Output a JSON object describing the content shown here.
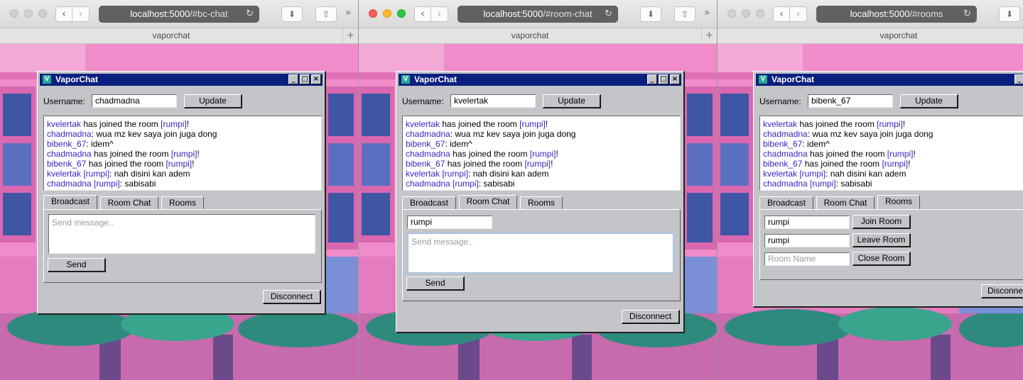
{
  "colors": {
    "title_bar": "#0a1f7f",
    "username_text": "#3b1ec2",
    "window_face": "#c3c5c9",
    "background_pink": "#ef8cc9"
  },
  "panes": [
    {
      "url_host": "localhost:5000",
      "url_path": "/#bc-chat",
      "tab_title": "vaporchat",
      "window_title": "VaporChat",
      "username_label": "Username:",
      "username_value": "chadmadna",
      "update_label": "Update",
      "active_tab": "Broadcast",
      "messages": [
        {
          "user": "kvelertak",
          "text": " has joined the room ",
          "room": "[rumpi]",
          "suffix": "!"
        },
        {
          "user": "chadmadna",
          "text": ": wua mz kev saya join juga dong",
          "room": "",
          "suffix": ""
        },
        {
          "user": "bibenk_67",
          "text": ": idem^",
          "room": "",
          "suffix": ""
        },
        {
          "user": "chadmadna",
          "text": " has joined the room ",
          "room": "[rumpi]",
          "suffix": "!"
        },
        {
          "user": "bibenk_67",
          "text": " has joined the room ",
          "room": "[rumpi]",
          "suffix": "!"
        },
        {
          "user": "kvelertak [rumpi]",
          "text": ": nah disini kan adem",
          "room": "",
          "suffix": ""
        },
        {
          "user": "chadmadna [rumpi]",
          "text": ": sabisabi",
          "room": "",
          "suffix": ""
        }
      ],
      "tabs": [
        "Broadcast",
        "Room Chat",
        "Rooms"
      ],
      "message_placeholder": "Send message..",
      "send_label": "Send",
      "disconnect_label": "Disconnect"
    },
    {
      "url_host": "localhost:5000",
      "url_path": "/#room-chat",
      "tab_title": "vaporchat",
      "window_title": "VaporChat",
      "username_label": "Username:",
      "username_value": "kvelertak",
      "update_label": "Update",
      "active_tab": "Room Chat",
      "messages": [
        {
          "user": "kvelertak",
          "text": " has joined the room ",
          "room": "[rumpi]",
          "suffix": "!"
        },
        {
          "user": "chadmadna",
          "text": ": wua mz kev saya join juga dong",
          "room": "",
          "suffix": ""
        },
        {
          "user": "bibenk_67",
          "text": ": idem^",
          "room": "",
          "suffix": ""
        },
        {
          "user": "chadmadna",
          "text": " has joined the room ",
          "room": "[rumpi]",
          "suffix": "!"
        },
        {
          "user": "bibenk_67",
          "text": " has joined the room ",
          "room": "[rumpi]",
          "suffix": "!"
        },
        {
          "user": "kvelertak [rumpi]",
          "text": ": nah disini kan adem",
          "room": "",
          "suffix": ""
        },
        {
          "user": "chadmadna [rumpi]",
          "text": ": sabisabi",
          "room": "",
          "suffix": ""
        }
      ],
      "tabs": [
        "Broadcast",
        "Room Chat",
        "Rooms"
      ],
      "room_value": "rumpi",
      "message_placeholder": "Send message..",
      "send_label": "Send",
      "disconnect_label": "Disconnect"
    },
    {
      "url_host": "localhost:5000",
      "url_path": "/#rooms",
      "tab_title": "vaporchat",
      "window_title": "VaporChat",
      "username_label": "Username:",
      "username_value": "bibenk_67",
      "update_label": "Update",
      "active_tab": "Rooms",
      "messages": [
        {
          "user": "kvelertak",
          "text": " has joined the room ",
          "room": "[rumpi]",
          "suffix": "!"
        },
        {
          "user": "chadmadna",
          "text": ": wua mz kev saya join juga dong",
          "room": "",
          "suffix": ""
        },
        {
          "user": "bibenk_67",
          "text": ": idem^",
          "room": "",
          "suffix": ""
        },
        {
          "user": "chadmadna",
          "text": " has joined the room ",
          "room": "[rumpi]",
          "suffix": "!"
        },
        {
          "user": "bibenk_67",
          "text": " has joined the room ",
          "room": "[rumpi]",
          "suffix": "!"
        },
        {
          "user": "kvelertak [rumpi]",
          "text": ": nah disini kan adem",
          "room": "",
          "suffix": ""
        },
        {
          "user": "chadmadna [rumpi]",
          "text": ": sabisabi",
          "room": "",
          "suffix": ""
        }
      ],
      "tabs": [
        "Broadcast",
        "Room Chat",
        "Rooms"
      ],
      "join_room_value": "rumpi",
      "join_room_label": "Join Room",
      "leave_room_value": "rumpi",
      "leave_room_label": "Leave Room",
      "close_room_placeholder": "Room Name",
      "close_room_label": "Close Room",
      "disconnect_label": "Disconnect"
    }
  ]
}
